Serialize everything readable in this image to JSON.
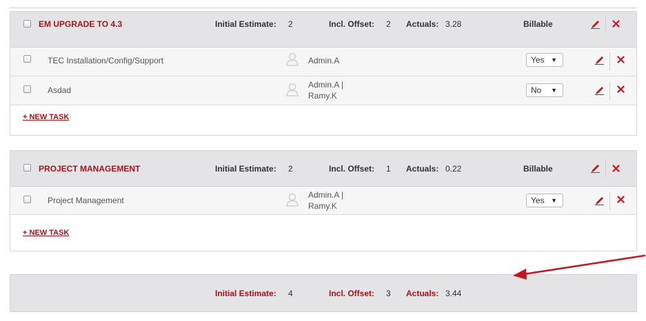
{
  "groups": [
    {
      "title": "EM UPGRADE TO 4.3",
      "initial_estimate_label": "Initial Estimate:",
      "initial_estimate": "2",
      "incl_offset_label": "Incl. Offset:",
      "incl_offset": "2",
      "actuals_label": "Actuals:",
      "actuals": "3.28",
      "billable_label": "Billable",
      "tasks": [
        {
          "name": "TEC Installation/Config/Support",
          "assignee_line1": "Admin.A",
          "assignee_line2": "",
          "billable": "Yes"
        },
        {
          "name": "Asdad",
          "assignee_line1": "Admin.A |",
          "assignee_line2": "Ramy.K",
          "billable": "No"
        }
      ],
      "new_task_label": "+ NEW TASK"
    },
    {
      "title": "PROJECT MANAGEMENT",
      "initial_estimate_label": "Initial Estimate:",
      "initial_estimate": "2",
      "incl_offset_label": "Incl. Offset:",
      "incl_offset": "1",
      "actuals_label": "Actuals:",
      "actuals": "0.22",
      "billable_label": "Billable",
      "tasks": [
        {
          "name": "Project Management",
          "assignee_line1": "Admin.A |",
          "assignee_line2": "Ramy.K",
          "billable": "Yes"
        }
      ],
      "new_task_label": "+ NEW TASK"
    }
  ],
  "totals": {
    "initial_estimate_label": "Initial Estimate:",
    "initial_estimate": "4",
    "incl_offset_label": "Incl. Offset:",
    "incl_offset": "3",
    "actuals_label": "Actuals:",
    "actuals": "3.44"
  },
  "icons": {
    "edit": "pencil-icon",
    "delete": "close-icon",
    "user": "user-silhouette-icon",
    "dropdown": "caret-down-icon"
  },
  "colors": {
    "accent_red": "#a3151d",
    "header_bg": "#e4e3e5",
    "row_bg": "#f6f6f6",
    "annotation_arrow": "#c4161c"
  }
}
